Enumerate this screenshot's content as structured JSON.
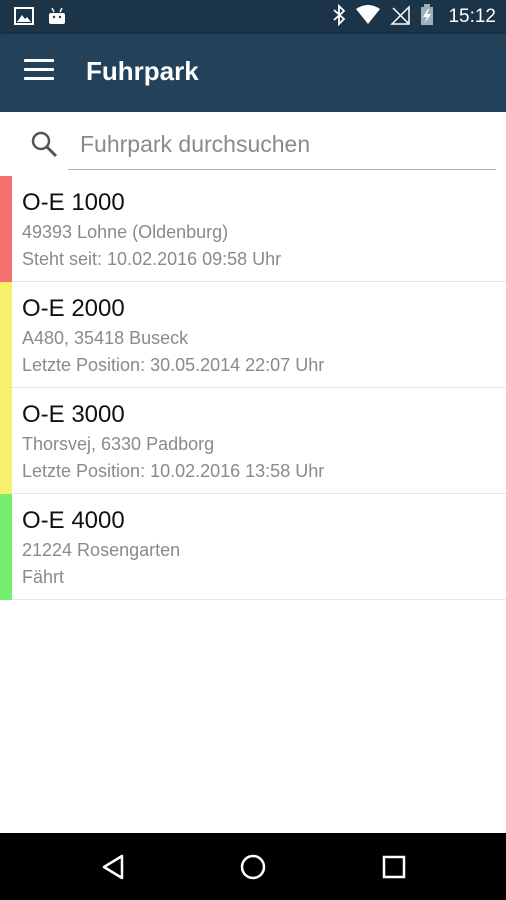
{
  "status_bar": {
    "time": "15:12",
    "icons": [
      "image-icon",
      "android-icon",
      "bluetooth-icon",
      "wifi-icon",
      "signal-icon",
      "battery-charging-icon"
    ]
  },
  "app_bar": {
    "title": "Fuhrpark",
    "menu_icon": "menu-icon"
  },
  "search": {
    "placeholder": "Fuhrpark durchsuchen",
    "value": "",
    "icon": "search-icon"
  },
  "vehicles": [
    {
      "plate": "O-E 1000",
      "location": "49393 Lohne (Oldenburg)",
      "status": "Steht seit: 10.02.2016 09:58 Uhr",
      "color": "#f37070"
    },
    {
      "plate": "O-E 2000",
      "location": "A480, 35418 Buseck",
      "status": "Letzte Position: 30.05.2014 22:07 Uhr",
      "color": "#f5f16a"
    },
    {
      "plate": "O-E 3000",
      "location": "Thorsvej, 6330 Padborg",
      "status": "Letzte Position: 10.02.2016 13:58 Uhr",
      "color": "#f5f16a"
    },
    {
      "plate": "O-E 4000",
      "location": "21224 Rosengarten",
      "status": "Fährt",
      "color": "#74ee6e"
    }
  ],
  "nav_bar": {
    "buttons": [
      "back-icon",
      "home-icon",
      "recents-icon"
    ]
  }
}
